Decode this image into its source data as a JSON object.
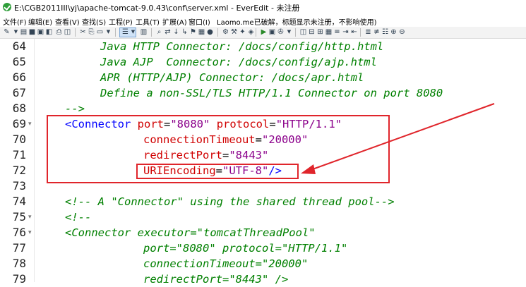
{
  "window": {
    "title": "E:\\CGB2011III\\yj\\apache-tomcat-9.0.43\\conf\\server.xml - EverEdit - 未注册"
  },
  "menu": [
    {
      "label": "文件(F)"
    },
    {
      "label": "编辑(E)"
    },
    {
      "label": "查看(V)"
    },
    {
      "label": "查找(S)"
    },
    {
      "label": "工程(P)"
    },
    {
      "label": "工具(T)"
    },
    {
      "label": "扩展(A)"
    },
    {
      "label": "窗口(I)"
    },
    {
      "label": "Laomo.me已破解，标题显示未注册，不影响使用)"
    }
  ],
  "toolbar": {
    "icons": [
      "new-file-icon",
      "open-icon",
      "save-icon",
      "save-all-icon",
      "close-icon",
      "print-icon",
      "cut-icon",
      "copy-icon",
      "paste-icon",
      "undo-icon",
      "redo-icon",
      "wrap-icon",
      "column-icon",
      "find-icon",
      "replace-icon",
      "find-next-icon",
      "goto-icon",
      "bookmark-icon",
      "macro-icon",
      "record-icon",
      "play-icon",
      "run-icon",
      "tool-icon",
      "compare-icon",
      "fold-icon",
      "unfold-icon",
      "indent-icon",
      "outdent-icon",
      "comment-icon",
      "uncomment-icon",
      "zoom-in-icon",
      "zoom-out-icon"
    ]
  },
  "editor": {
    "lines": [
      {
        "num": "64",
        "fold": ""
      },
      {
        "num": "65",
        "fold": ""
      },
      {
        "num": "66",
        "fold": ""
      },
      {
        "num": "67",
        "fold": ""
      },
      {
        "num": "68",
        "fold": ""
      },
      {
        "num": "69",
        "fold": "▾"
      },
      {
        "num": "70",
        "fold": ""
      },
      {
        "num": "71",
        "fold": ""
      },
      {
        "num": "72",
        "fold": ""
      },
      {
        "num": "73",
        "fold": ""
      },
      {
        "num": "74",
        "fold": ""
      },
      {
        "num": "75",
        "fold": "▾"
      },
      {
        "num": "76",
        "fold": "▾"
      },
      {
        "num": "77",
        "fold": ""
      },
      {
        "num": "78",
        "fold": ""
      },
      {
        "num": "79",
        "fold": ""
      }
    ],
    "code": {
      "l64": "Java HTTP Connector: /docs/config/http.html",
      "l65": "Java AJP  Connector: /docs/config/ajp.html",
      "l66": "APR (HTTP/AJP) Connector: /docs/apr.html",
      "l67": "Define a non-SSL/TLS HTTP/1.1 Connector on port 8080",
      "l68": "-->",
      "l69_tag": "<Connector",
      "l69_a1": "port",
      "l69_v1": "\"8080\"",
      "l69_a2": "protocol",
      "l69_v2": "\"HTTP/1.1\"",
      "l70_a": "connectionTimeout",
      "l70_v": "\"20000\"",
      "l71_a": "redirectPort",
      "l71_v": "\"8443\"",
      "l72_a": "URIEncoding",
      "l72_v": "\"UTF-8\"",
      "l72_end": "/>",
      "l74": "<!-- A \"Connector\" using the shared thread pool-->",
      "l75": "<!--",
      "l76_tag": "<Connector",
      "l76_rest": "executor=\"tomcatThreadPool\"",
      "l77": "port=\"8080\" protocol=\"HTTP/1.1\"",
      "l78": "connectionTimeout=\"20000\"",
      "l79": "redirectPort=\"8443\" />",
      "eq": "="
    }
  },
  "colors": {
    "comment": "#008000",
    "tag": "#0000ff",
    "attribute": "#d00000",
    "value": "#8b008b",
    "annotation": "#e0252b"
  }
}
